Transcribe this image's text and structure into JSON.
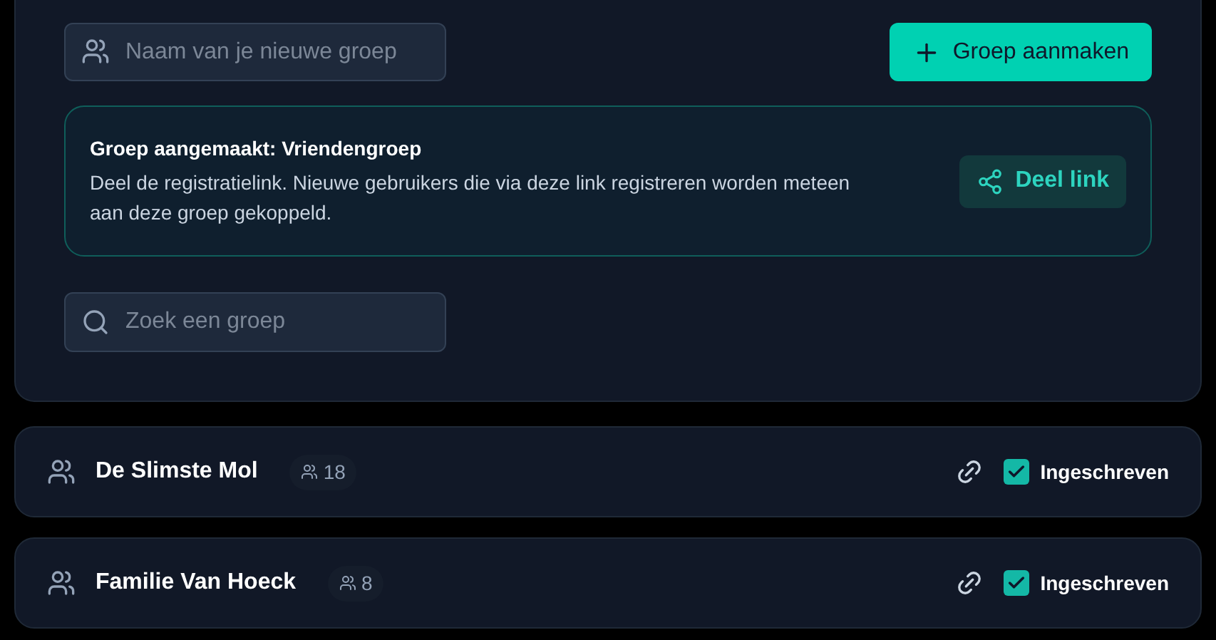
{
  "new_group": {
    "placeholder": "Naam van je nieuwe groep",
    "button": "Groep aanmaken"
  },
  "notice": {
    "title": "Groep aangemaakt: Vriendengroep",
    "text": "Deel de registratielink. Nieuwe gebruikers die via deze link registreren worden meteen aan deze groep gekoppeld.",
    "button": "Deel link"
  },
  "search": {
    "placeholder": "Zoek een groep"
  },
  "groups": [
    {
      "name": "De Slimste Mol",
      "members": "18",
      "checked": true,
      "status": "Ingeschreven"
    },
    {
      "name": "Familie Van Hoeck",
      "members": "8",
      "checked": true,
      "status": "Ingeschreven"
    }
  ]
}
